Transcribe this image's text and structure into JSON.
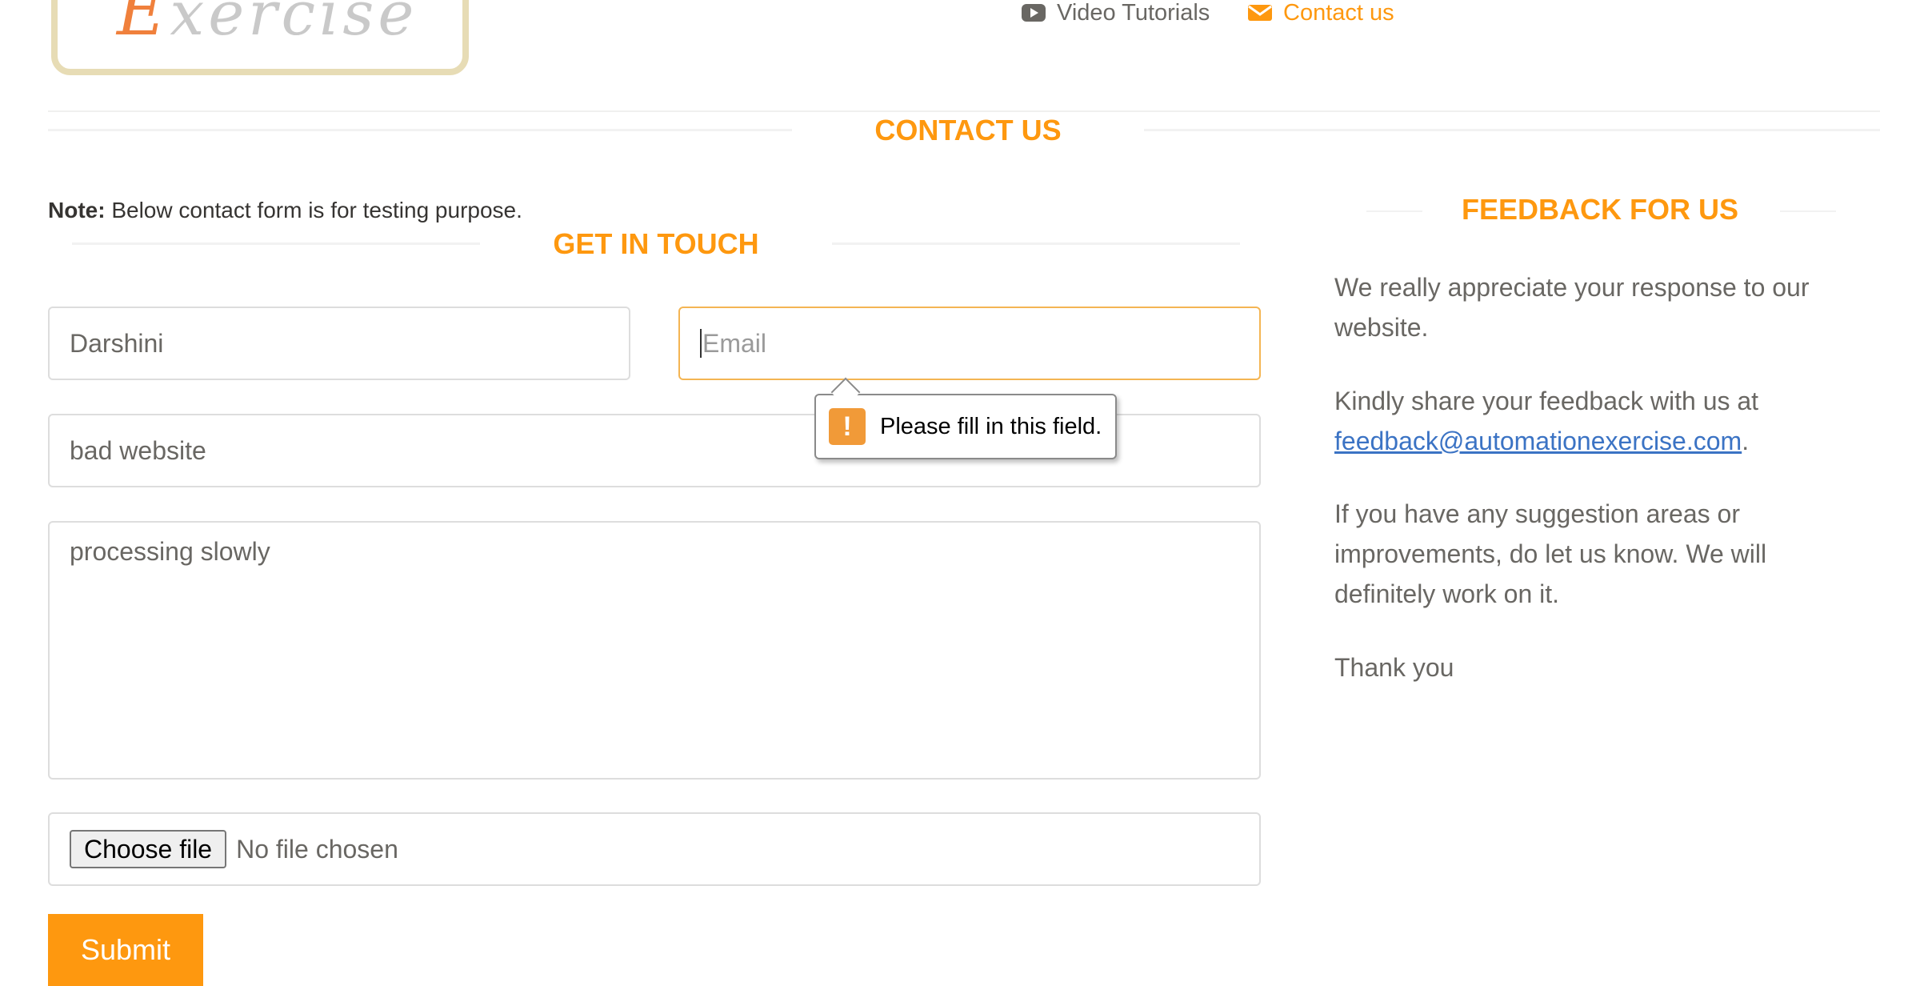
{
  "logo": {
    "text_first": "E",
    "text_rest": "xercise"
  },
  "nav": {
    "video_tutorials": "Video Tutorials",
    "contact_us": "Contact us"
  },
  "page": {
    "title": "CONTACT US",
    "note_label": "Note:",
    "note_text": " Below contact form is for testing purpose."
  },
  "form": {
    "title": "GET IN TOUCH",
    "name_value": "Darshini",
    "email_placeholder": "Email",
    "subject_value": "bad website",
    "message_value": "processing slowly",
    "file_button": "Choose file",
    "file_status": "No file chosen",
    "submit_label": "Submit"
  },
  "validation": {
    "message": "Please fill in this field.",
    "icon": "!"
  },
  "feedback": {
    "title": "FEEDBACK FOR US",
    "para1": "We really appreciate your response to our website.",
    "para2_text": "Kindly share your feedback with us at ",
    "para2_email": "feedback@automationexercise.com",
    "para2_end": ".",
    "para3": "If you have any suggestion areas or improvements, do let us know. We will definitely work on it.",
    "para4": "Thank you"
  },
  "colors": {
    "accent": "#fe980f",
    "text": "#696763",
    "link": "#3b73c4",
    "focus_border": "#f4b553",
    "warning": "#f19a38"
  }
}
